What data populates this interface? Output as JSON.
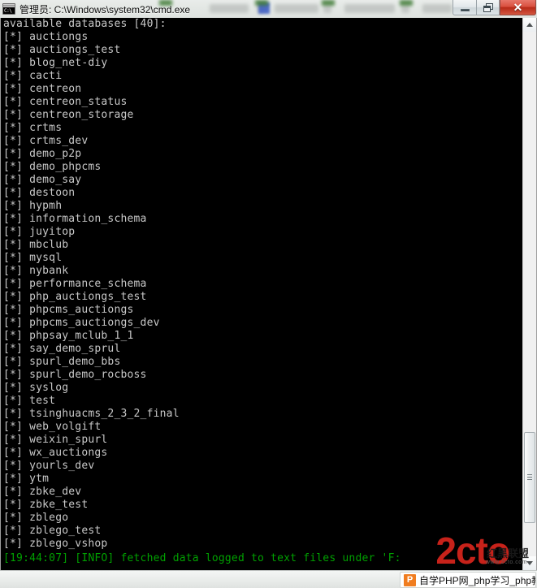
{
  "window": {
    "title": "管理员: C:\\Windows\\system32\\cmd.exe",
    "icon_name": "cmd-icon",
    "icon_prompt": "C:\\",
    "controls": {
      "minimize_label": "Minimize",
      "restore_label": "Restore",
      "close_label": "✕"
    }
  },
  "console": {
    "heading": "available databases [40]:",
    "marker": "[*] ",
    "databases": [
      "auctiongs",
      "auctiongs_test",
      "blog_net-diy",
      "cacti",
      "centreon",
      "centreon_status",
      "centreon_storage",
      "crtms",
      "crtms_dev",
      "demo_p2p",
      "demo_phpcms",
      "demo_say",
      "destoon",
      "hypmh",
      "information_schema",
      "juyitop",
      "mbclub",
      "mysql",
      "nybank",
      "performance_schema",
      "php_auctiongs_test",
      "phpcms_auctiongs",
      "phpcms_auctiongs_dev",
      "phpsay_mclub_1_1",
      "say_demo_sprul",
      "spurl_demo_bbs",
      "spurl_demo_rocboss",
      "syslog",
      "test",
      "tsinghuacms_2_3_2_final",
      "web_volgift",
      "weixin_spurl",
      "wx_auctiongs",
      "yourls_dev",
      "ytm",
      "zbke_dev",
      "zbke_test",
      "zblego",
      "zblego_test",
      "zblego_vshop"
    ],
    "status_line": "[19:44:07] [INFO] fetched data logged to text files under 'F:",
    "status_color": "#00a000",
    "background_color": "#000000",
    "foreground_color": "#c0c0c0"
  },
  "scrollbar": {
    "up_arrow_name": "scroll-up-arrow",
    "down_arrow_name": "scroll-down-arrow"
  },
  "watermark": {
    "logo": "2cto",
    "cn_text": "红黑联盟",
    "sub_text": "www.2cto.com"
  },
  "taskbar": {
    "item_icon": "P",
    "item_label": "自学PHP网_php学习_php教程"
  }
}
